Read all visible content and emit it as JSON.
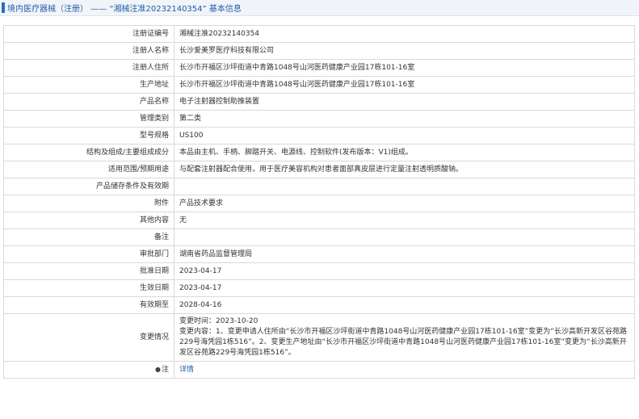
{
  "page": {
    "title": "境内医疗器械（注册） —— “湘械注准20232140354” 基本信息"
  },
  "rows": [
    {
      "label": "注册证编号",
      "value": "湘械注准20232140354"
    },
    {
      "label": "注册人名称",
      "value": "长沙爱美罗医疗科技有限公司"
    },
    {
      "label": "注册人住所",
      "value": "长沙市开福区沙坪街道中青路1048号山河医药健康产业园17栋101-16室"
    },
    {
      "label": "生产地址",
      "value": "长沙市开福区沙坪街道中青路1048号山河医药健康产业园17栋101-16室"
    },
    {
      "label": "产品名称",
      "value": "电子注射器控制助推装置"
    },
    {
      "label": "管理类别",
      "value": "第二类"
    },
    {
      "label": "型号规格",
      "value": "US100"
    },
    {
      "label": "结构及组成/主要组成成分",
      "value": "本品由主机、手柄、脚踏开关、电源线、控制软件(发布版本：V1)组成。"
    },
    {
      "label": "适用范围/预期用途",
      "value": "与配套注射器配合使用，用于医疗美容机构对患者面部真皮层进行定量注射透明质酸钠。"
    },
    {
      "label": "产品储存条件及有效期",
      "value": ""
    },
    {
      "label": "附件",
      "value": "产品技术要求"
    },
    {
      "label": "其他内容",
      "value": "无"
    },
    {
      "label": "备注",
      "value": ""
    },
    {
      "label": "审批部门",
      "value": "湖南省药品监督管理局"
    },
    {
      "label": "批准日期",
      "value": "2023-04-17"
    },
    {
      "label": "生效日期",
      "value": "2023-04-17"
    },
    {
      "label": "有效期至",
      "value": "2028-04-16"
    }
  ],
  "change": {
    "label": "变更情况",
    "time": "变更时间：2023-10-20",
    "content": "变更内容：1、变更申请人住所由“长沙市开福区沙坪街道中青路1048号山河医药健康产业园17栋101-16室”变更为“长沙高新开发区谷苑路229号海凭园1栋516”。2、变更生产地址由“长沙市开福区沙坪街道中青路1048号山河医药健康产业园17栋101-16室”变更为“长沙高新开发区谷苑路229号海凭园1栋516”。"
  },
  "note": {
    "label": "注",
    "icon": "pin-icon",
    "link_text": "详情"
  },
  "colors": {
    "title_text": "#1f5ea8",
    "title_bar_bg": "#f1f4f8",
    "border": "#d9d9d9",
    "link": "#1f5ea8"
  }
}
